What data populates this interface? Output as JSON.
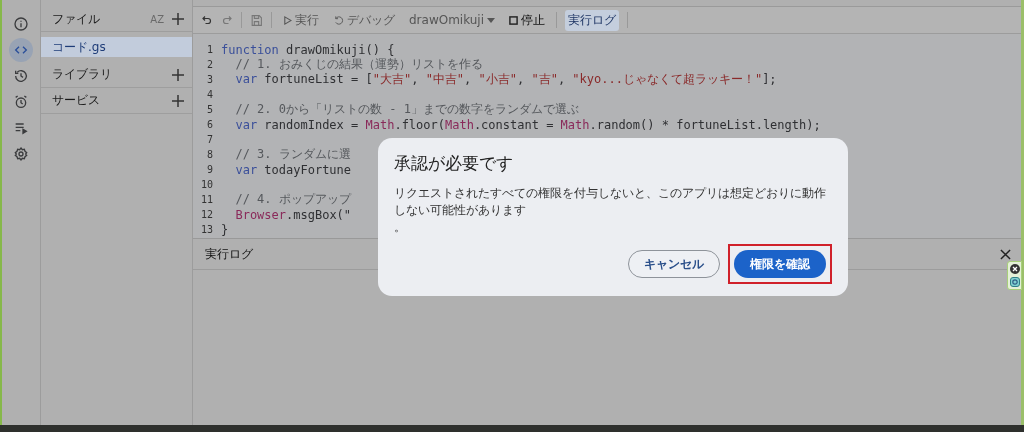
{
  "rail": [
    {
      "kind": "info",
      "selected": false
    },
    {
      "kind": "code",
      "selected": true
    },
    {
      "kind": "history",
      "selected": false
    },
    {
      "kind": "alarm",
      "selected": false
    },
    {
      "kind": "executions",
      "selected": false
    },
    {
      "kind": "settings",
      "selected": false
    }
  ],
  "files_panel": {
    "title": "ファイル",
    "sort_label": "AZ",
    "files": [
      {
        "name": "コード.gs",
        "selected": true
      }
    ],
    "sections": [
      {
        "label": "ライブラリ"
      },
      {
        "label": "サービス"
      }
    ]
  },
  "toolbar": {
    "run": {
      "label": "実行",
      "disabled": true
    },
    "debug": {
      "label": "デバッグ",
      "disabled": true
    },
    "function": "drawOmikuji",
    "stop": {
      "label": "停止"
    },
    "log_button": {
      "label": "実行ログ",
      "selected": true
    }
  },
  "editor": {
    "lines": [
      {
        "number": "1",
        "segments": [
          {
            "kind": "keyword",
            "text": "function"
          },
          {
            "kind": "plain",
            "text": " drawOmikuji() {"
          }
        ]
      },
      {
        "number": "2",
        "segments": [
          {
            "kind": "comment",
            "text": "  // 1. おみくじの結果（運勢）リストを作る"
          }
        ]
      },
      {
        "number": "3",
        "segments": [
          {
            "kind": "keyword",
            "text": "  var"
          },
          {
            "kind": "plain",
            "text": " fortuneList = ["
          },
          {
            "kind": "string",
            "text": "\"大吉\""
          },
          {
            "kind": "plain",
            "text": ", "
          },
          {
            "kind": "string",
            "text": "\"中吉\""
          },
          {
            "kind": "plain",
            "text": ", "
          },
          {
            "kind": "string",
            "text": "\"小吉\""
          },
          {
            "kind": "plain",
            "text": ", "
          },
          {
            "kind": "string",
            "text": "\"吉\""
          },
          {
            "kind": "plain",
            "text": ", "
          },
          {
            "kind": "string",
            "text": "\"kyo...じゃなくて超ラッキー！\""
          },
          {
            "kind": "plain",
            "text": "];"
          }
        ]
      },
      {
        "number": "4"
      },
      {
        "number": "5",
        "segments": [
          {
            "kind": "comment",
            "text": "  // 2. 0から「リストの数 - 1」までの数字をランダムで選ぶ"
          }
        ]
      },
      {
        "number": "6",
        "segments": [
          {
            "kind": "keyword",
            "text": "  var"
          },
          {
            "kind": "plain",
            "text": " randomIndex = "
          },
          {
            "kind": "object",
            "text": "Math"
          },
          {
            "kind": "plain",
            "text": ".floor("
          },
          {
            "kind": "object",
            "text": "Math"
          },
          {
            "kind": "plain",
            "text": ".constant = "
          },
          {
            "kind": "object",
            "text": "Math"
          },
          {
            "kind": "plain",
            "text": ".random() * fortuneList.length);"
          }
        ]
      },
      {
        "number": "7"
      },
      {
        "number": "8",
        "segments": [
          {
            "kind": "comment",
            "text": "  // 3. ランダムに選"
          }
        ]
      },
      {
        "number": "9",
        "segments": [
          {
            "kind": "keyword",
            "text": "  var"
          },
          {
            "kind": "plain",
            "text": " todayFortune"
          }
        ]
      },
      {
        "number": "10"
      },
      {
        "number": "11",
        "segments": [
          {
            "kind": "comment",
            "text": "  // 4. ポップアップ"
          }
        ]
      },
      {
        "number": "12",
        "segments": [
          {
            "kind": "object",
            "text": "  Browser"
          },
          {
            "kind": "plain",
            "text": ".msgBox(\""
          }
        ]
      },
      {
        "number": "13",
        "segments": [
          {
            "kind": "plain",
            "text": "}"
          }
        ]
      }
    ]
  },
  "log_panel": {
    "title": "実行ログ"
  },
  "dialog": {
    "title": "承認が必要です",
    "message": "リクエストされたすべての権限を付与しないと、このアプリは想定どおりに動作しない可能性があります",
    "note": "。",
    "buttons": [
      {
        "label": "キャンセル",
        "kind": "outlined",
        "highlighted": false
      },
      {
        "label": "権限を確認",
        "kind": "filled",
        "highlighted": true
      }
    ]
  }
}
